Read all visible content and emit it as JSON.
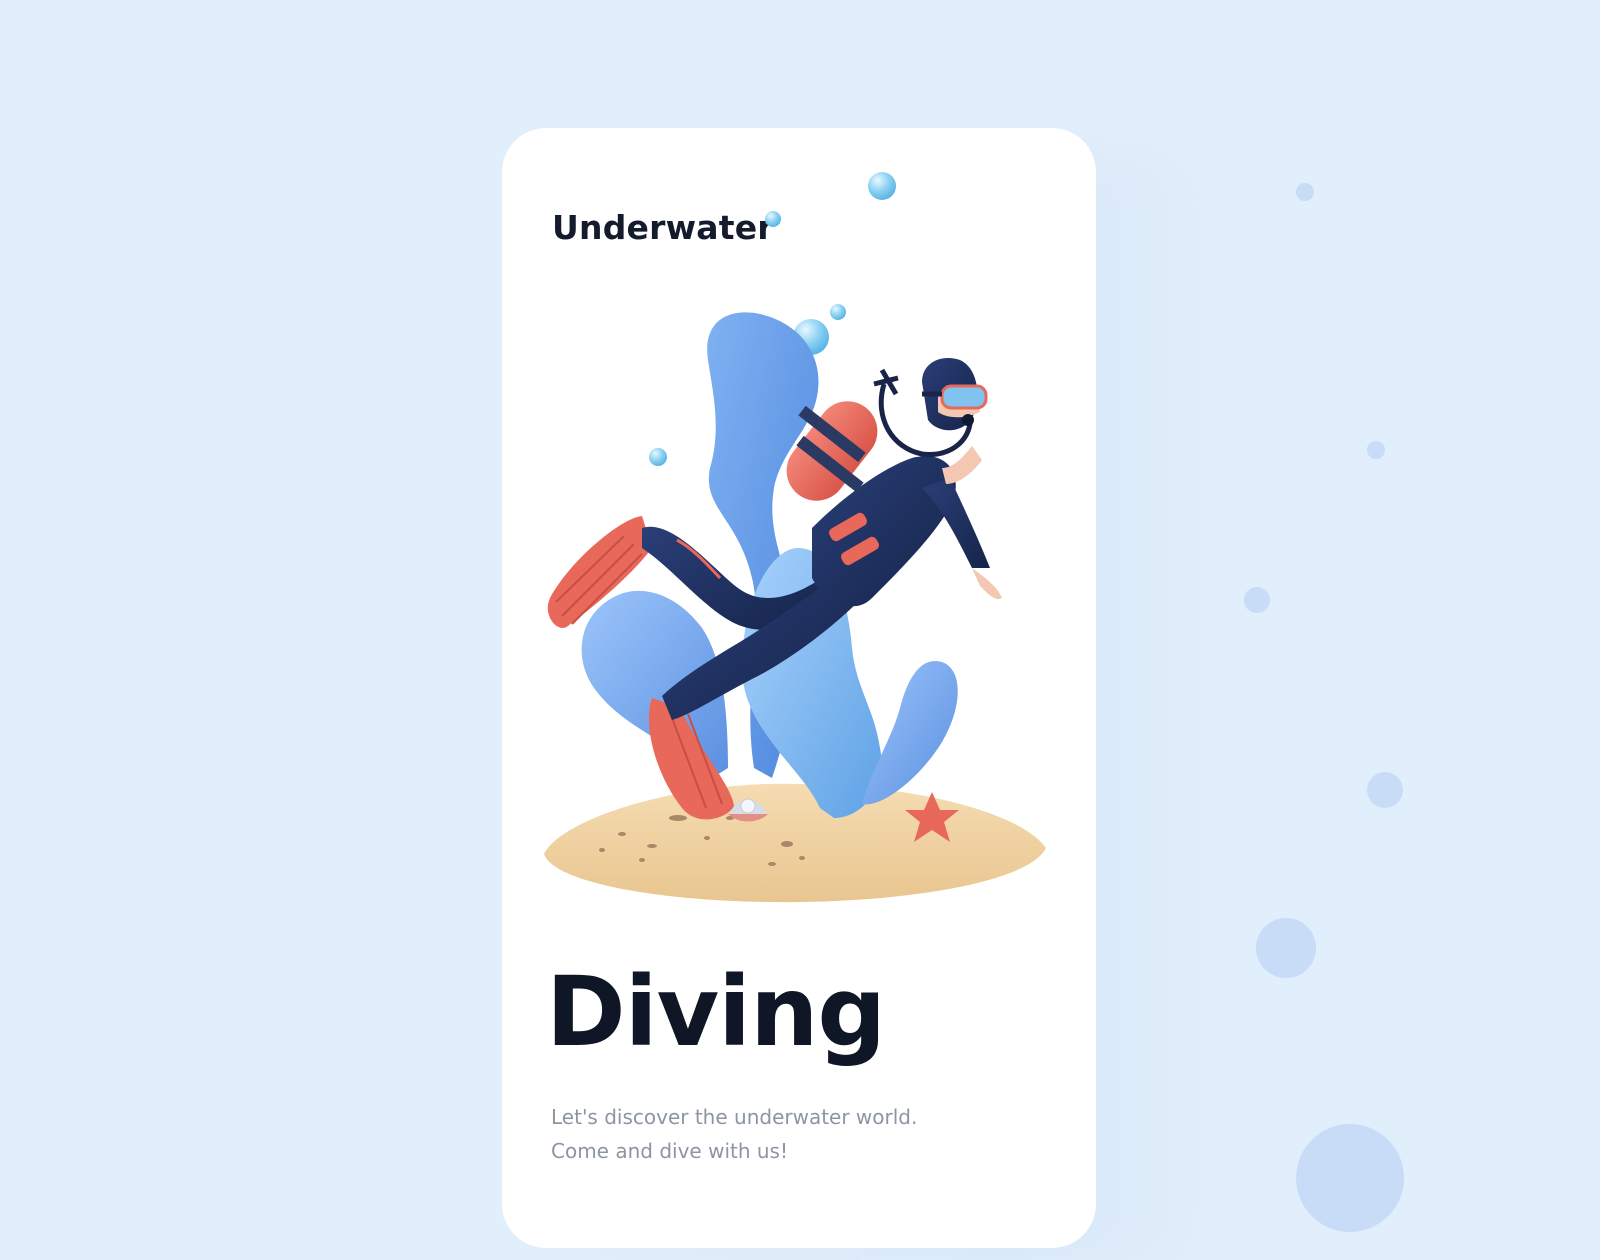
{
  "app": {
    "brand": "Underwater"
  },
  "hero": {
    "title": "Diving",
    "subtitle_line1": "Let's discover the underwater world.",
    "subtitle_line2": "Come and dive with us!"
  },
  "illustration": {
    "subject": "scuba-diver",
    "elements": [
      "diver",
      "air-tank",
      "fins",
      "coral",
      "sand-island",
      "starfish",
      "pearl-shell",
      "bubbles"
    ]
  },
  "colors": {
    "background": "#e1eefb",
    "card": "#ffffff",
    "heading": "#0f1626",
    "body_text": "#8d95a3",
    "coral_blue": "#6fa3ec",
    "suit_navy": "#1d2e5c",
    "accent_red": "#e8685a",
    "sand": "#f3d6aa"
  }
}
